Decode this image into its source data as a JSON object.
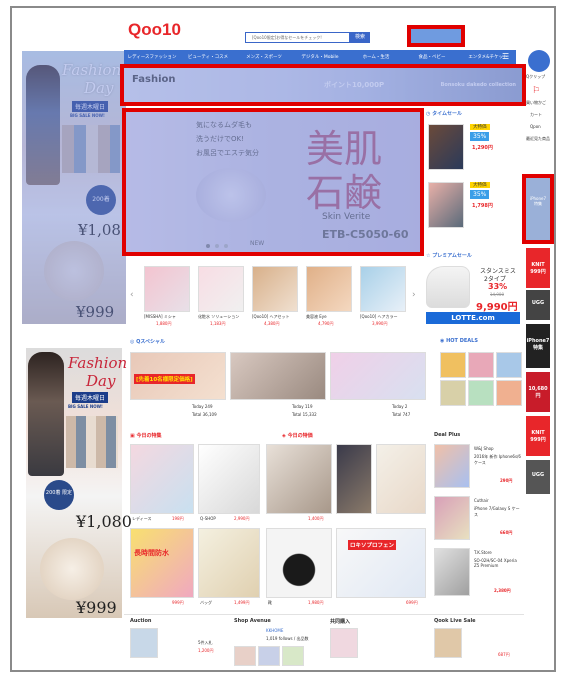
{
  "header": {
    "logo": "Qoo10",
    "search_placeholder": "[Qoo10限定]お得なセールをチェック!",
    "search_button": "検索"
  },
  "nav": {
    "items": [
      "レディースファッション",
      "ビューティ・コスメ",
      "メンズ・スポーツ",
      "デジタル・Mobile",
      "ホーム・生活",
      "食品・ベビー",
      "エンタメ&チケット"
    ]
  },
  "left_ads": [
    {
      "title": "Fashion",
      "title2": "Day",
      "badge": "毎週木曜日",
      "sale": "BIG SALE NOW!",
      "limit": "200着",
      "price1": "¥1,080",
      "price2": "¥999"
    },
    {
      "title": "Fashion",
      "title2": "Day",
      "badge": "毎週木曜日",
      "sale": "BIG SALE NOW!",
      "limit": "200着\n限定",
      "price1": "¥1,080",
      "price2": "¥999"
    }
  ],
  "top_banner": {
    "left_text": "Fashion",
    "sub_text": "ポイント10,000P",
    "right_text": "Bonsoku dakedo collection"
  },
  "main_banner": {
    "line1": "気になるムダ毛も",
    "line2": "洗うだけでOK!",
    "line3": "お風呂でエステ気分",
    "title_a": "美肌",
    "title_b": "石鹸",
    "brand": "Skin Verite",
    "tag": "NEW",
    "code": "ETB-C5050-60"
  },
  "time_sale": {
    "title": "タイムセール",
    "items": [
      {
        "label": "大特価",
        "discount": "35%",
        "price": "1,290円"
      },
      {
        "label": "大特価",
        "discount": "35%",
        "price": "1,798円"
      }
    ]
  },
  "brand_strip": {
    "items": [
      {
        "name": "[MISSHA] ミシャ",
        "price": "1,880円"
      },
      {
        "name": "化粧水 ソリューション",
        "price": "1,183円"
      },
      {
        "name": "[Qoo10] ヘアセット",
        "price": "4,380円"
      },
      {
        "name": "美容液 Eye",
        "price": "4,790円"
      },
      {
        "name": "[Qoo10] ヘアカラー",
        "price": "3,990円"
      }
    ]
  },
  "premium": {
    "title": "プレミアムセール",
    "brand": "LOTTE.com",
    "product": "スタンスミス",
    "type": "2タイプ",
    "discount": "33%",
    "old_price": "14,900",
    "price": "9,990円"
  },
  "special": {
    "title": "Qスペシャル",
    "caption": "[先着10名様限定価格]",
    "stats": [
      {
        "label": "Today",
        "today": "249",
        "total_label": "Total",
        "total": "36,109"
      },
      {
        "label": "Today",
        "today": "119",
        "total_label": "Total",
        "total": "15,332"
      },
      {
        "label": "Today",
        "today": "2",
        "total_label": "Total",
        "total": "747"
      }
    ]
  },
  "hot_deals": {
    "title": "HOT DEALS"
  },
  "today_special": {
    "title": "今日の特価"
  },
  "featured": {
    "title": "今日の特集",
    "items": [
      {
        "name": "レディース",
        "price": "198円"
      },
      {
        "name": "Q-SHOP",
        "price": "2,990円"
      },
      {
        "name": "ファッション",
        "price": "1,400円"
      },
      {
        "name": "靴",
        "price": "1,980円"
      },
      {
        "name": "長時間防水",
        "price": "999円"
      },
      {
        "name": "バッグ",
        "price": "1,499円"
      },
      {
        "name": "ロキソプロフェン",
        "price": "699円"
      }
    ]
  },
  "deal_plus": {
    "title": "Deal Plus",
    "items": [
      {
        "shop": "W&J Shop",
        "desc": "2016年 新作 Iphone6s/6 ケース",
        "price": "290円"
      },
      {
        "shop": "Cuthair",
        "desc": "iPhone 7/Galaxy S ケース",
        "price": "660円"
      },
      {
        "shop": "T.K.Store",
        "desc": "SO-02H/SC-04 Xperia Z5 Premium",
        "price": "2,380円"
      }
    ]
  },
  "bottom": {
    "auction": "Auction",
    "shop_avenue": "Shop Avenue",
    "shop_name": "KKHOME",
    "shop_meta": "1,019 follows / 出品数",
    "group": "共同購入",
    "qoo_live": "Qook Live Sale",
    "auction_price": "1,200円",
    "auction_count": "5件入札",
    "live_price": "687円"
  },
  "right_sidebar": {
    "items": [
      "Qクリップ",
      "買い物かご",
      "カート",
      "Qpon",
      "最近見た商品"
    ],
    "ads": [
      "KNIT 999円",
      "UGG",
      "iPhone7 特集",
      "10,680円",
      "KNIT 999円",
      "UGG"
    ]
  },
  "right_highlight": {
    "line1": "iPhone7",
    "line2": "特集"
  }
}
